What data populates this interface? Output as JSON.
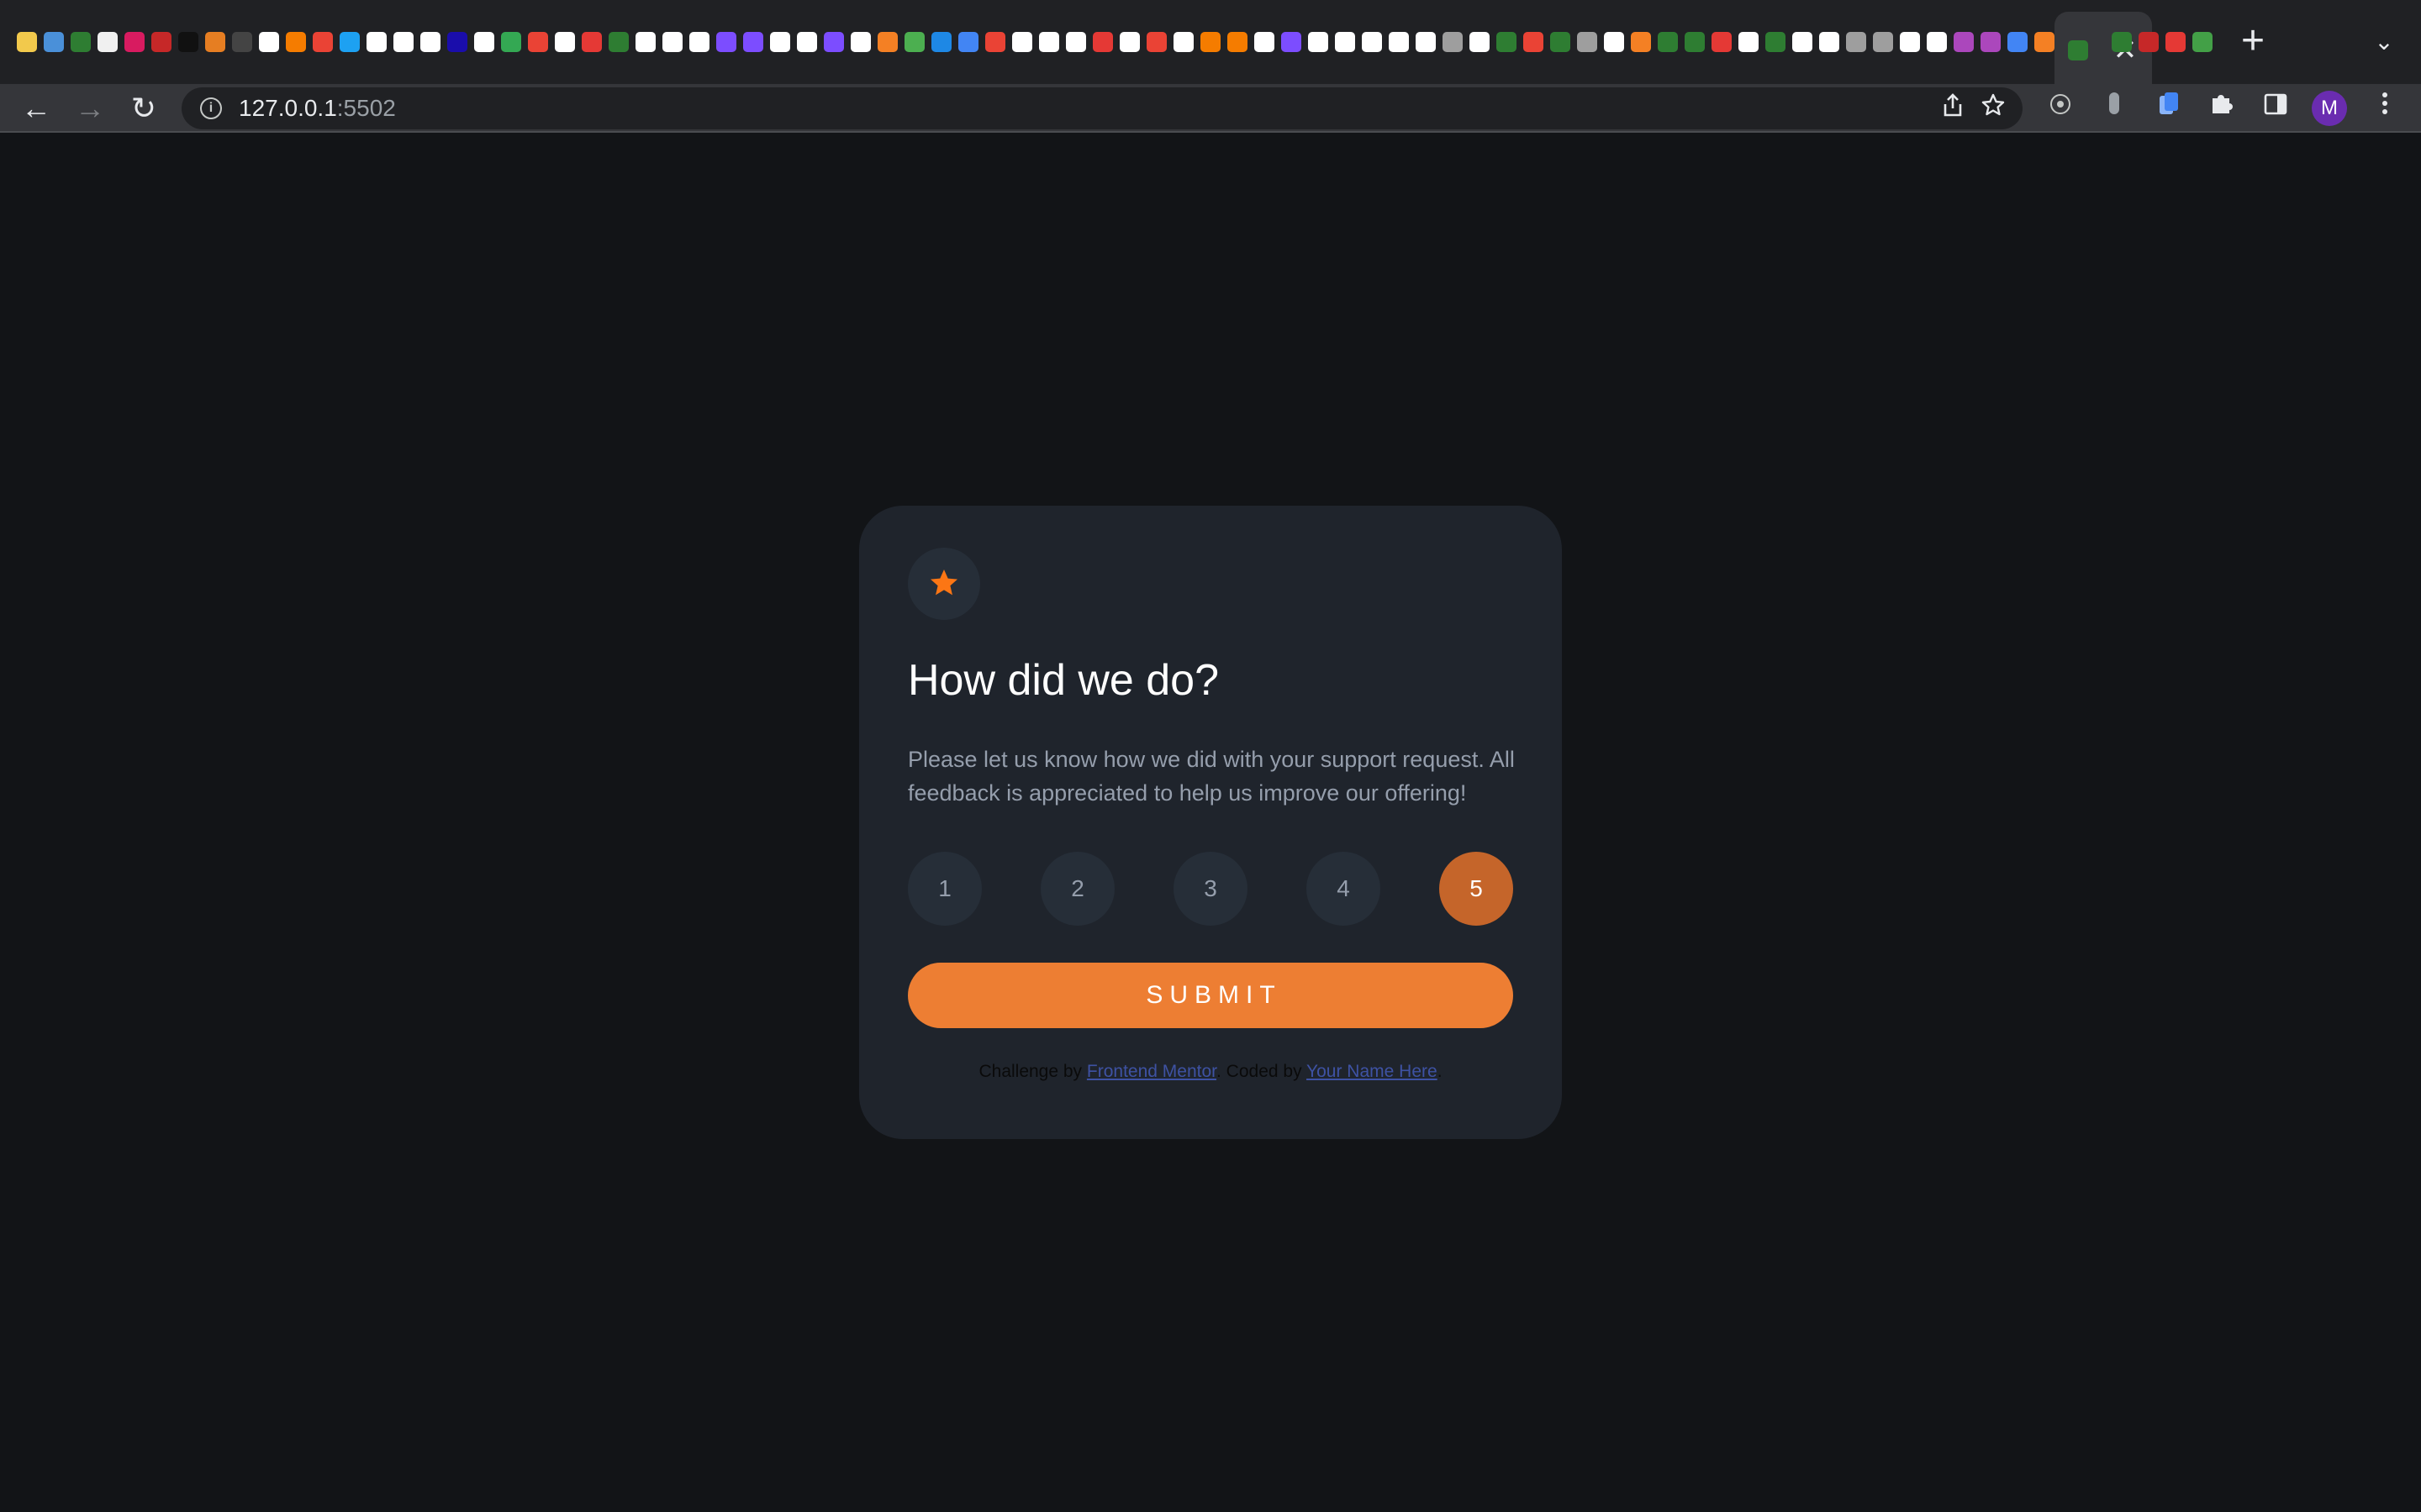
{
  "browser": {
    "tab_close_symbol": "✕",
    "new_tab_symbol": "+",
    "tab_list_symbol": "⌄",
    "nav": {
      "back_symbol": "←",
      "forward_symbol": "→",
      "reload_symbol": "↻"
    },
    "omnibox": {
      "host": "127.0.0.1",
      "port": ":5502",
      "info_symbol": "i"
    },
    "profile_initial": "M",
    "favicon_colors": [
      "#f2c94c",
      "#4a90d9",
      "#2e7d32",
      "#f0f0f0",
      "#d81b60",
      "#c62828",
      "#111111",
      "#e67e22",
      "#444444",
      "#ffffff",
      "#f57c00",
      "#ea4335",
      "#1da1f2",
      "#ffffff",
      "#ffffff",
      "#ffffff",
      "#1a0dab",
      "#ffffff",
      "#34a853",
      "#ea4335",
      "#ffffff",
      "#e53935",
      "#2e7d32",
      "#ffffff",
      "#ffffff",
      "#ffffff",
      "#7c4dff",
      "#7c4dff",
      "#ffffff",
      "#ffffff",
      "#7c4dff",
      "#ffffff",
      "#f48024",
      "#4caf50",
      "#1e88e5",
      "#4285f4",
      "#ea4335",
      "#ffffff",
      "#ffffff",
      "#ffffff",
      "#e53935",
      "#ffffff",
      "#ea4335",
      "#ffffff",
      "#f57c00",
      "#f57c00",
      "#ffffff",
      "#7c4dff",
      "#ffffff",
      "#ffffff",
      "#ffffff",
      "#ffffff",
      "#ffffff",
      "#9e9e9e",
      "#ffffff",
      "#2e7d32",
      "#ea4335",
      "#2e7d32",
      "#9e9e9e",
      "#ffffff",
      "#f48024",
      "#2e7d32",
      "#2e7d32",
      "#e53935",
      "#ffffff",
      "#2e7d32",
      "#ffffff",
      "#ffffff",
      "#9e9e9e",
      "#9e9e9e",
      "#ffffff",
      "#ffffff",
      "#ab47bc",
      "#ab47bc",
      "#4285f4",
      "#f48024"
    ],
    "extra_favicon_colors": [
      "#2e7d32",
      "#c62828",
      "#e53935",
      "#43a047"
    ]
  },
  "card": {
    "star_color": "#fc7614",
    "heading": "How did we do?",
    "description": "Please let us know how we did with your support request. All feedback is appreciated to help us improve our offering!",
    "ratings": [
      "1",
      "2",
      "3",
      "4",
      "5"
    ],
    "selected_rating": "5",
    "submit_label": "SUBMIT",
    "attribution": {
      "prefix": "Challenge by",
      "link1": "Frontend Mentor",
      "middle": ". Coded by",
      "link2": "Your Name Here",
      "suffix": "."
    }
  }
}
